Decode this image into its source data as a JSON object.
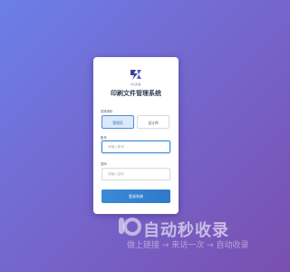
{
  "login": {
    "logo_caption": "屹岩科技",
    "title": "印刷文件管理系统",
    "role_label": "选择身份",
    "roles": [
      {
        "label": "管理员",
        "selected": true
      },
      {
        "label": "设计师",
        "selected": false
      }
    ],
    "account_label": "账号",
    "account_placeholder": "请输入账号",
    "password_label": "密码",
    "password_placeholder": "请输入密码",
    "submit_label": "登录系统"
  },
  "watermark": {
    "brand": "自动秒收录",
    "tagline": "做上链接 → 来访一次 → 自动收录"
  },
  "colors": {
    "accent": "#3b8ad6",
    "background_start": "#6b7fe8",
    "background_end": "#7a4fb0"
  }
}
